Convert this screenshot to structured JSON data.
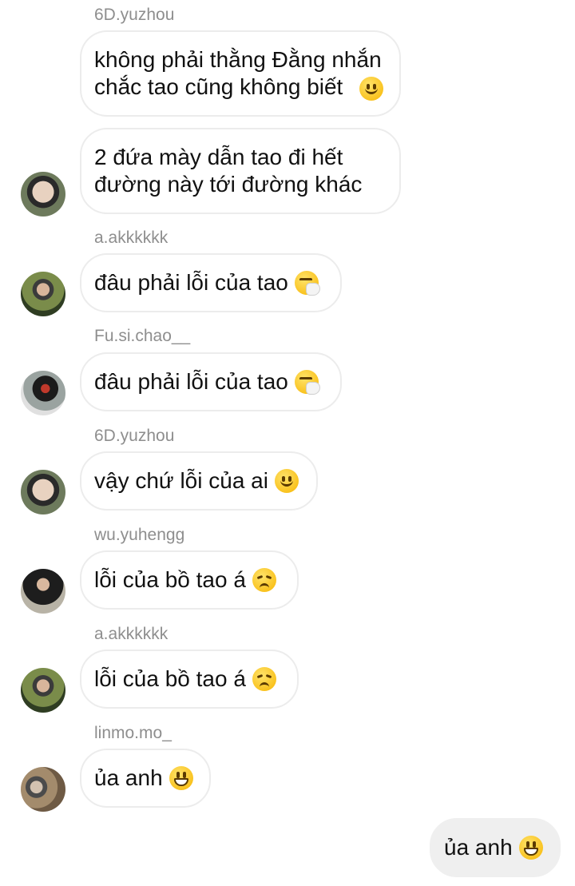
{
  "messages": [
    {
      "sender": "6D.yuzhou",
      "text": "không phải thằng Đằng nhắn\nchắc tao cũng không biết",
      "emoji": "slightly-smiling-face"
    },
    {
      "sender": "",
      "text": "2 đứa mày dẫn tao đi hết\nđường này tới đường khác",
      "emoji": ""
    },
    {
      "sender": "a.akkkkkk",
      "text": "đâu phải lỗi của tao",
      "emoji": "sneezing-face"
    },
    {
      "sender": "Fu.si.chao__",
      "text": "đâu phải lỗi của tao",
      "emoji": "sneezing-face"
    },
    {
      "sender": "6D.yuzhou",
      "text": "vậy chứ lỗi của ai",
      "emoji": "slightly-smiling-face"
    },
    {
      "sender": "wu.yuhengg",
      "text": "lỗi của bồ tao á",
      "emoji": "disappointed-face"
    },
    {
      "sender": "a.akkkkkk",
      "text": "lỗi của bồ tao á",
      "emoji": "disappointed-face"
    },
    {
      "sender": "linmo.mo_",
      "text": "ủa anh",
      "emoji": "grinning-face"
    }
  ],
  "outgoing": {
    "text": "ủa anh",
    "emoji": "grinning-face"
  },
  "colors": {
    "incoming_bubble_border": "#ececec",
    "outgoing_bubble": "#efefef",
    "sender_text": "#8e8e8e"
  }
}
